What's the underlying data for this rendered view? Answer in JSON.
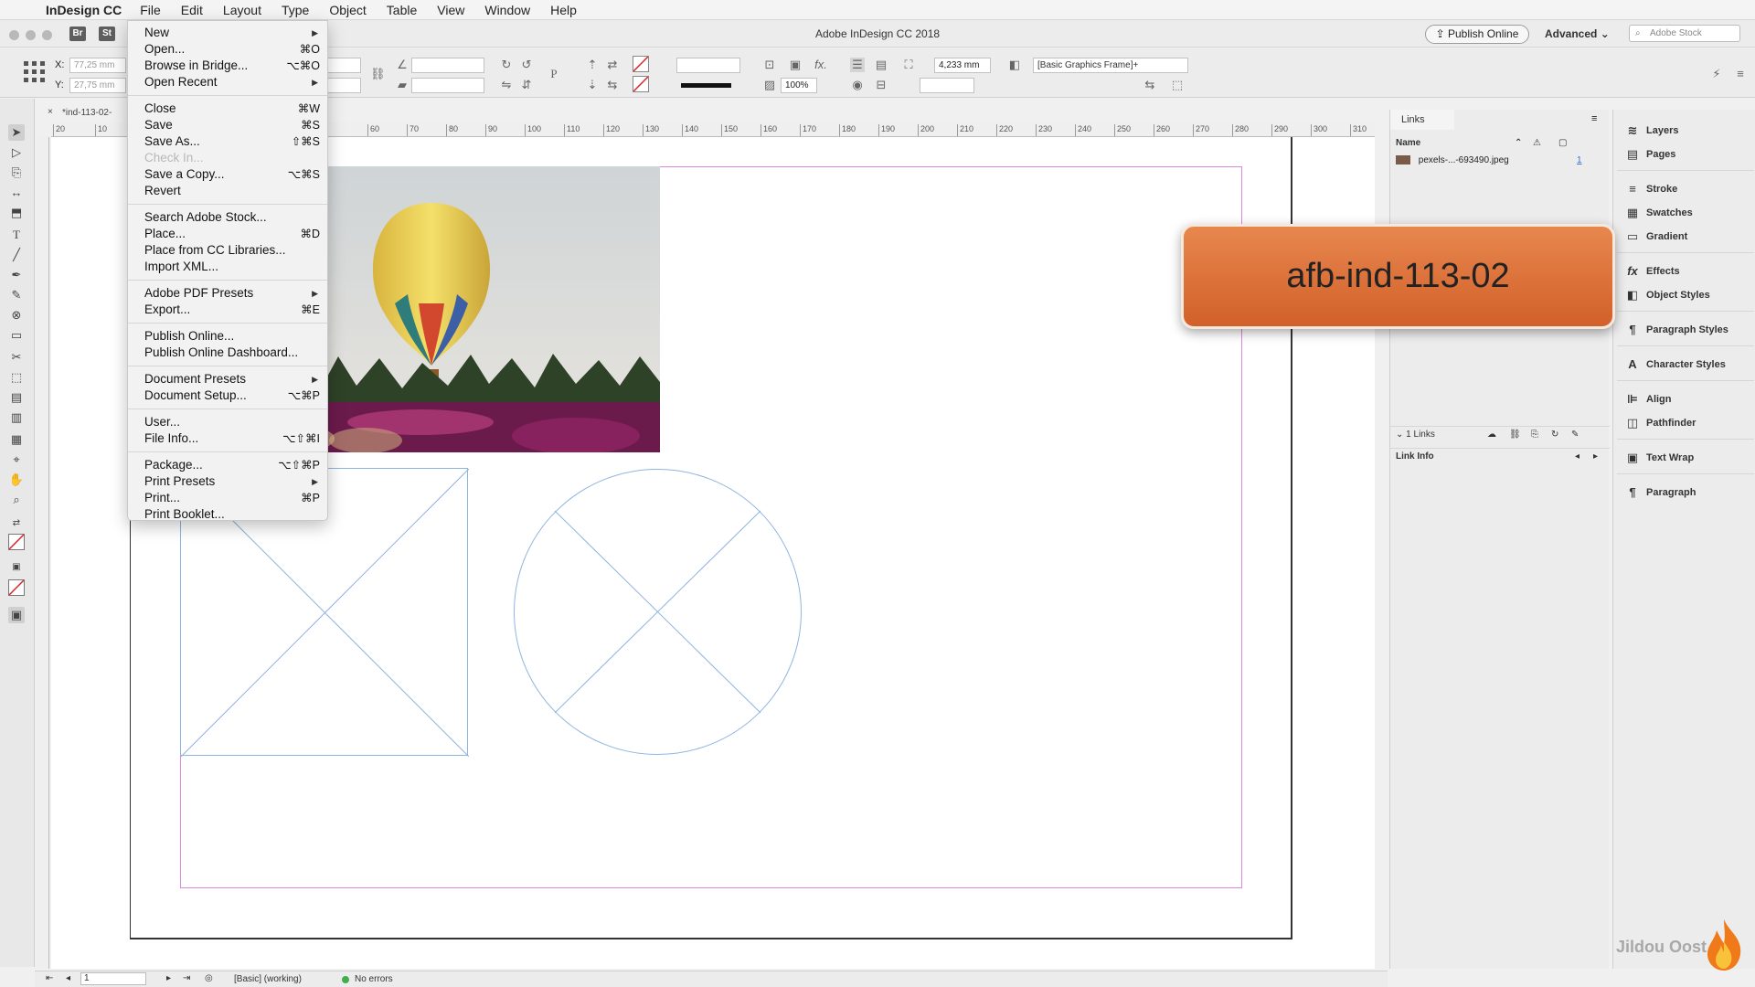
{
  "menubar": {
    "app_name": "InDesign CC",
    "menus": [
      "File",
      "Edit",
      "Layout",
      "Type",
      "Object",
      "Table",
      "View",
      "Window",
      "Help"
    ]
  },
  "titlebar": {
    "badges": [
      "Br",
      "St"
    ],
    "document_title": "Adobe InDesign CC 2018",
    "publish_label": "Publish Online",
    "workspace_label": "Advanced",
    "stock_placeholder": "Adobe Stock"
  },
  "control_panel": {
    "x_label": "X:",
    "y_label": "Y:",
    "x_value": "77,25 mm",
    "y_value": "27,75 mm",
    "stroke_weight": "4,233 mm",
    "scale_value": "100%",
    "object_style": "[Basic Graphics Frame]+"
  },
  "doc_tab": {
    "label": "*ind-113-02-"
  },
  "ruler_h": [
    "20",
    "10",
    "60",
    "70",
    "80",
    "90",
    "100",
    "110",
    "120",
    "130",
    "140",
    "150",
    "160",
    "170",
    "180",
    "190",
    "200",
    "210",
    "220",
    "230",
    "240",
    "250",
    "260",
    "270",
    "280",
    "290",
    "300",
    "310"
  ],
  "file_menu": {
    "items": [
      {
        "label": "New",
        "shortcut": "",
        "submenu": true,
        "disabled": false
      },
      {
        "label": "Open...",
        "shortcut": "⌘O",
        "submenu": false,
        "disabled": false
      },
      {
        "label": "Browse in Bridge...",
        "shortcut": "⌥⌘O",
        "submenu": false,
        "disabled": false
      },
      {
        "label": "Open Recent",
        "shortcut": "",
        "submenu": true,
        "disabled": false
      },
      {
        "sep": true
      },
      {
        "label": "Close",
        "shortcut": "⌘W",
        "submenu": false,
        "disabled": false
      },
      {
        "label": "Save",
        "shortcut": "⌘S",
        "submenu": false,
        "disabled": false
      },
      {
        "label": "Save As...",
        "shortcut": "⇧⌘S",
        "submenu": false,
        "disabled": false
      },
      {
        "label": "Check In...",
        "shortcut": "",
        "submenu": false,
        "disabled": true
      },
      {
        "label": "Save a Copy...",
        "shortcut": "⌥⌘S",
        "submenu": false,
        "disabled": false
      },
      {
        "label": "Revert",
        "shortcut": "",
        "submenu": false,
        "disabled": false
      },
      {
        "sep": true
      },
      {
        "label": "Search Adobe Stock...",
        "shortcut": "",
        "submenu": false,
        "disabled": false
      },
      {
        "label": "Place...",
        "shortcut": "⌘D",
        "submenu": false,
        "disabled": false
      },
      {
        "label": "Place from CC Libraries...",
        "shortcut": "",
        "submenu": false,
        "disabled": false
      },
      {
        "label": "Import XML...",
        "shortcut": "",
        "submenu": false,
        "disabled": false
      },
      {
        "sep": true
      },
      {
        "label": "Adobe PDF Presets",
        "shortcut": "",
        "submenu": true,
        "disabled": false
      },
      {
        "label": "Export...",
        "shortcut": "⌘E",
        "submenu": false,
        "disabled": false
      },
      {
        "sep": true
      },
      {
        "label": "Publish Online...",
        "shortcut": "",
        "submenu": false,
        "disabled": false
      },
      {
        "label": "Publish Online Dashboard...",
        "shortcut": "",
        "submenu": false,
        "disabled": false
      },
      {
        "sep": true
      },
      {
        "label": "Document Presets",
        "shortcut": "",
        "submenu": true,
        "disabled": false
      },
      {
        "label": "Document Setup...",
        "shortcut": "⌥⌘P",
        "submenu": false,
        "disabled": false
      },
      {
        "sep": true
      },
      {
        "label": "User...",
        "shortcut": "",
        "submenu": false,
        "disabled": false
      },
      {
        "label": "File Info...",
        "shortcut": "⌥⇧⌘I",
        "submenu": false,
        "disabled": false
      },
      {
        "sep": true
      },
      {
        "label": "Package...",
        "shortcut": "⌥⇧⌘P",
        "submenu": false,
        "disabled": false
      },
      {
        "label": "Print Presets",
        "shortcut": "",
        "submenu": true,
        "disabled": false
      },
      {
        "label": "Print...",
        "shortcut": "⌘P",
        "submenu": false,
        "disabled": false
      },
      {
        "label": "Print Booklet...",
        "shortcut": "",
        "submenu": false,
        "disabled": false
      }
    ]
  },
  "links_panel": {
    "tab": "Links",
    "col_name": "Name",
    "file_name": "pexels-...-693490.jpeg",
    "page_ref": "1",
    "links_count": "1 Links",
    "link_info": "Link Info"
  },
  "dock": {
    "items": [
      {
        "label": "Layers",
        "icon": "layers-icon",
        "glyph": "≋"
      },
      {
        "label": "Pages",
        "icon": "pages-icon",
        "glyph": "▤"
      },
      {
        "label": "Stroke",
        "icon": "stroke-icon",
        "glyph": "≡"
      },
      {
        "label": "Swatches",
        "icon": "swatches-icon",
        "glyph": "▦"
      },
      {
        "label": "Gradient",
        "icon": "gradient-icon",
        "glyph": "▭"
      },
      {
        "label": "Effects",
        "icon": "effects-icon",
        "glyph": "fx"
      },
      {
        "label": "Object Styles",
        "icon": "object-styles-icon",
        "glyph": "◧"
      },
      {
        "label": "Paragraph Styles",
        "icon": "paragraph-styles-icon",
        "glyph": "¶"
      },
      {
        "label": "Character Styles",
        "icon": "character-styles-icon",
        "glyph": "A"
      },
      {
        "label": "Align",
        "icon": "align-icon",
        "glyph": "⊫"
      },
      {
        "label": "Pathfinder",
        "icon": "pathfinder-icon",
        "glyph": "◫"
      },
      {
        "label": "Text Wrap",
        "icon": "text-wrap-icon",
        "glyph": "▣"
      },
      {
        "label": "Paragraph",
        "icon": "paragraph-icon",
        "glyph": "¶"
      }
    ]
  },
  "statusbar": {
    "page_number": "1",
    "preflight_profile": "[Basic] (working)",
    "errors": "No errors"
  },
  "overlay": {
    "label": "afb-ind-113-02"
  },
  "watermark": {
    "text": "Jildou Oost"
  },
  "colors": {
    "accent_orange": "#d9682f",
    "margin_magenta": "#d98bd9",
    "frame_blue": "#8fb4e0",
    "status_ok_green": "#3cb04a"
  }
}
